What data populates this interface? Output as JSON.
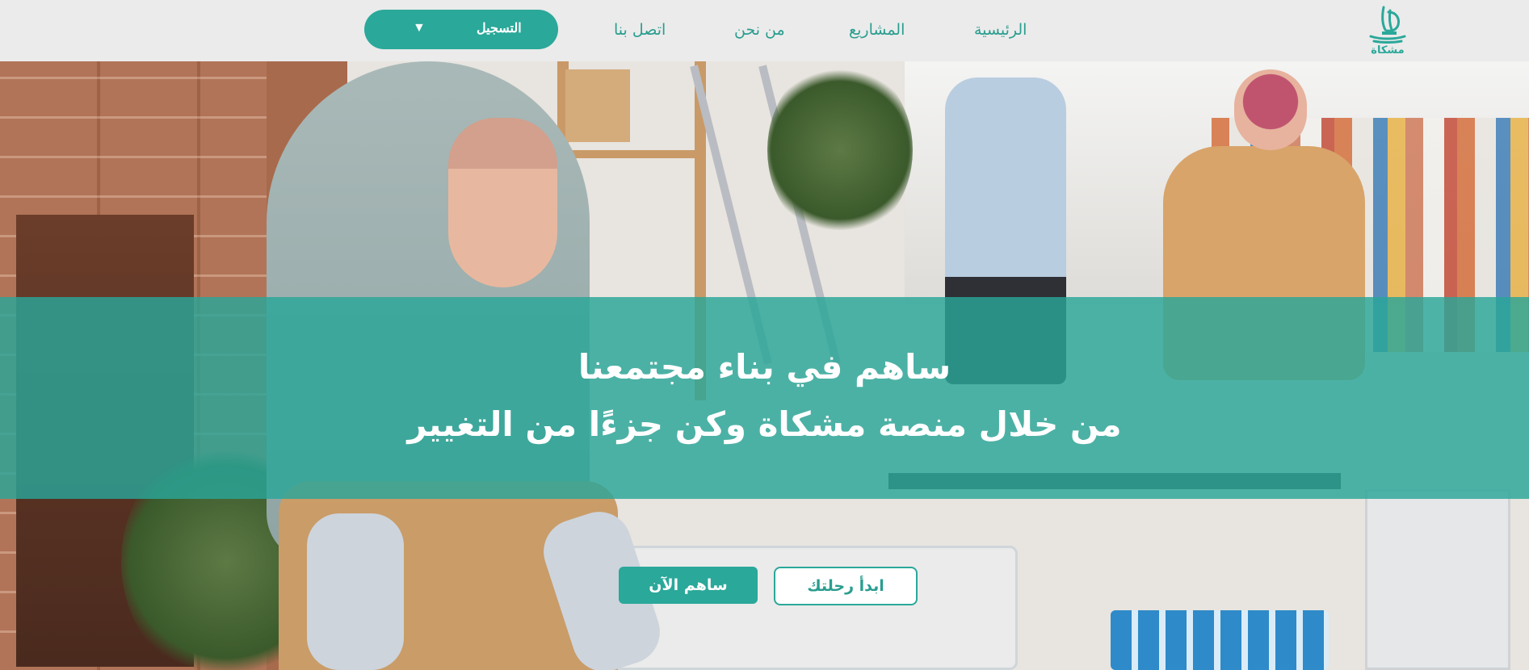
{
  "brand": {
    "logo_text": "مشكاة",
    "accent_color": "#2aa89a"
  },
  "nav": {
    "items": [
      {
        "label": "الرئيسية"
      },
      {
        "label": "المشاريع"
      },
      {
        "label": "من نحن"
      },
      {
        "label": "اتصل بنا"
      }
    ],
    "register": {
      "label": "التسجيل",
      "caret_icon": "caret-down-icon"
    }
  },
  "hero": {
    "headline": "ساهم في بناء مجتمعنا",
    "subline": "من خلال منصة مشكاة وكن جزءًا من التغيير",
    "primary_button": "ساهم الآن",
    "secondary_button": "ابدأ رحلتك"
  }
}
